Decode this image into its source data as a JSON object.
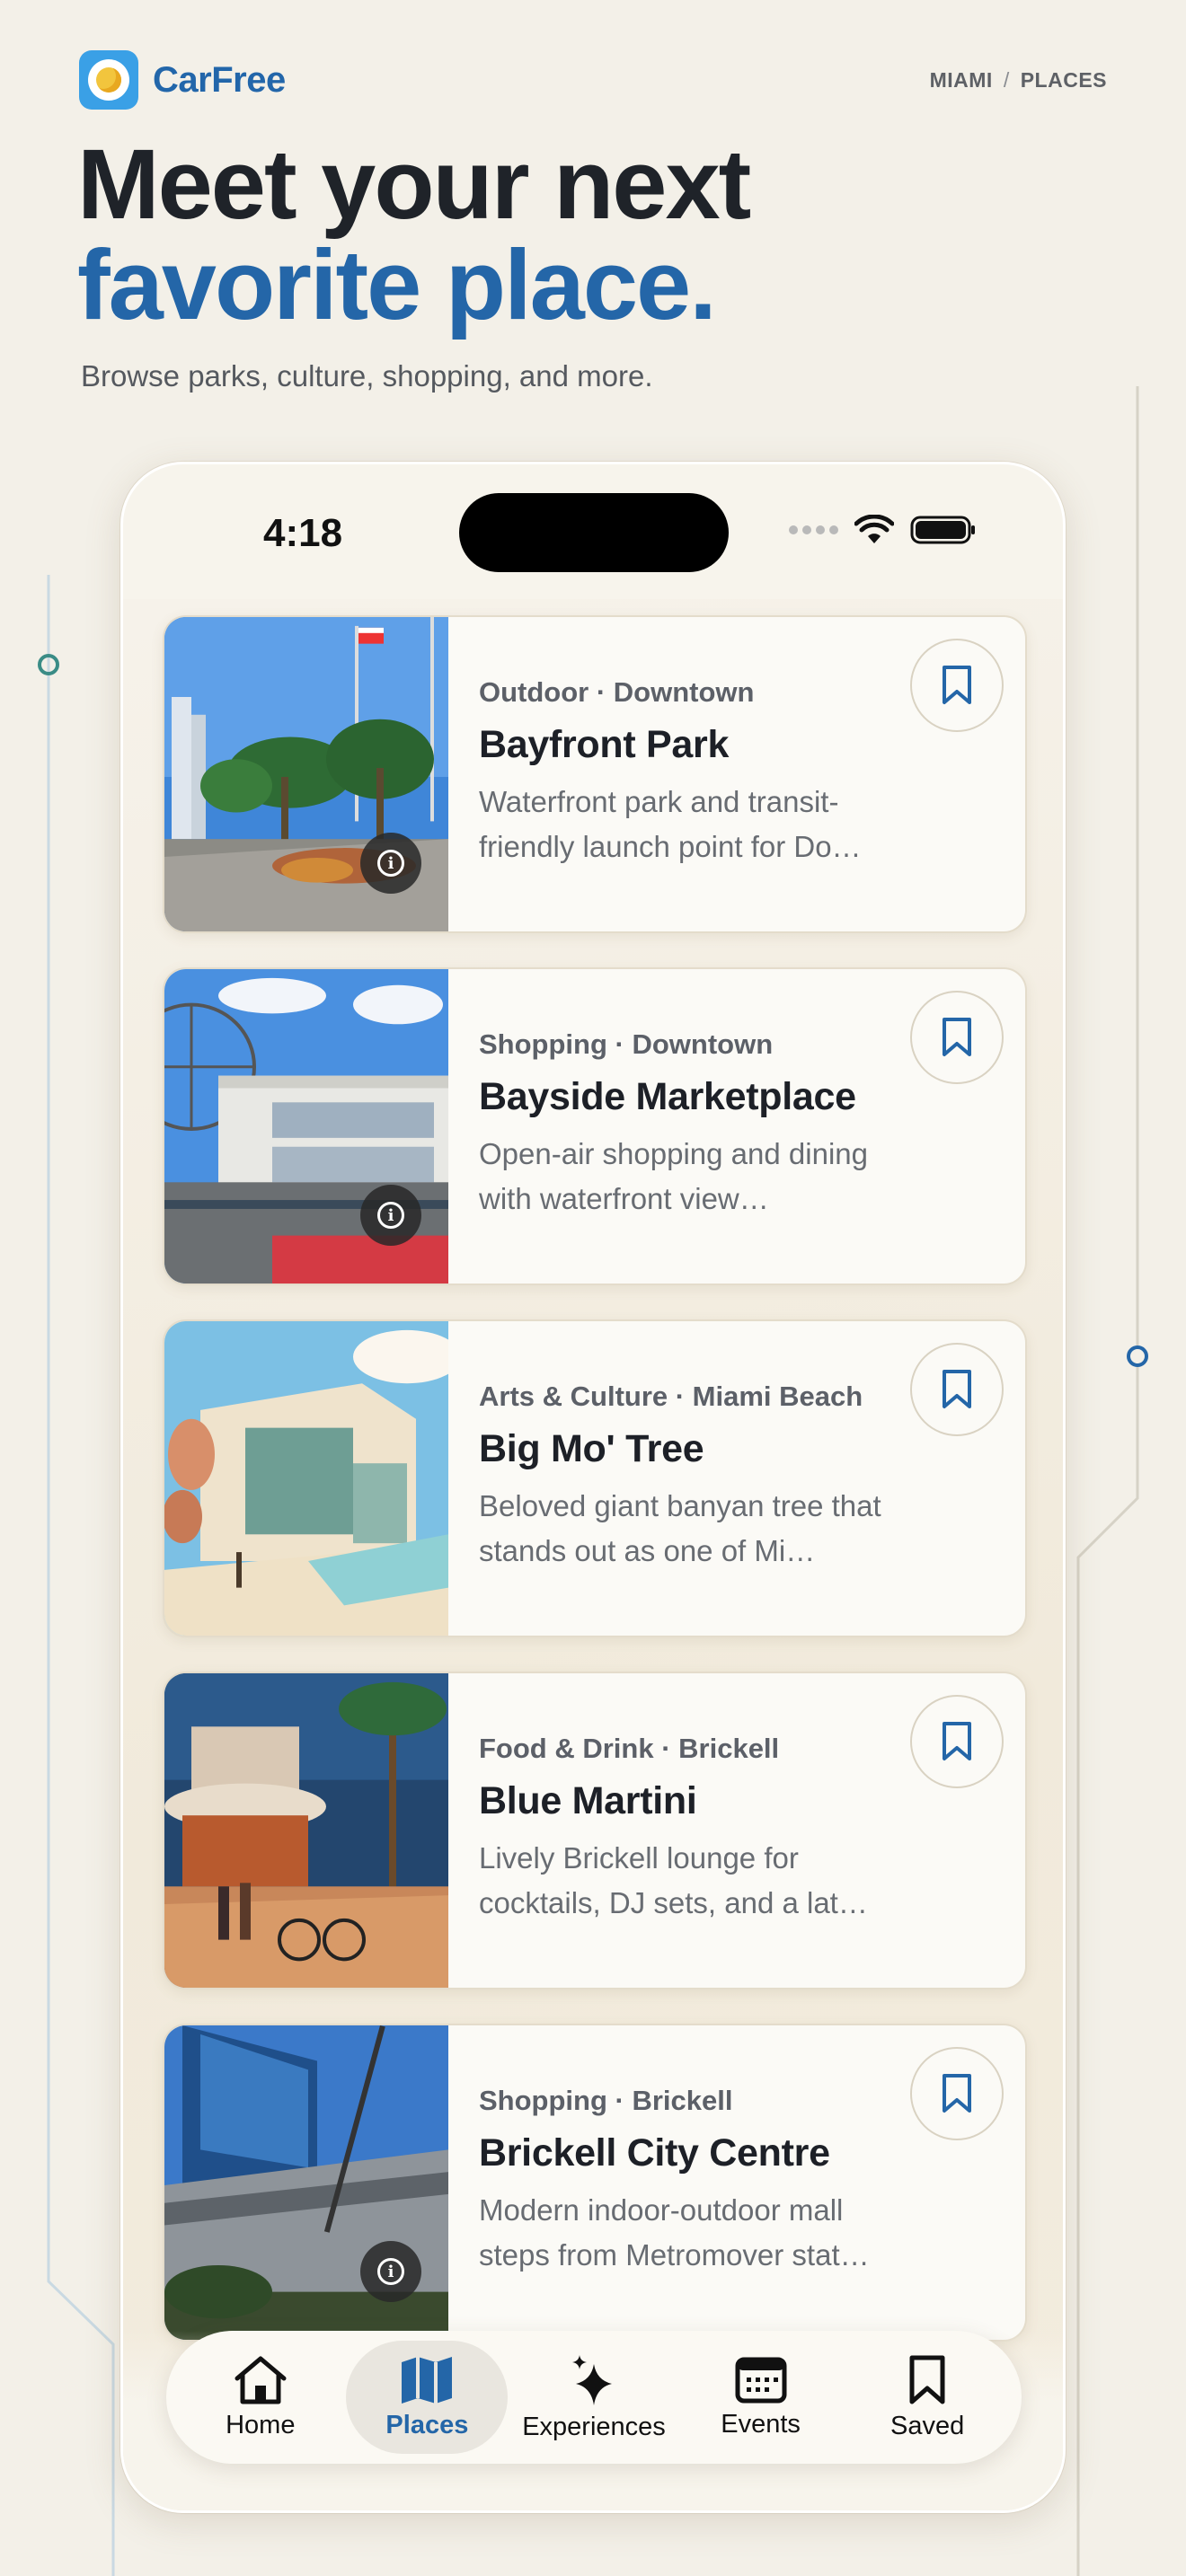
{
  "brand": {
    "name": "CarFree"
  },
  "breadcrumb": {
    "city": "MIAMI",
    "separator": "/",
    "section": "PLACES"
  },
  "hero": {
    "title_line1": "Meet your next",
    "title_line2": "favorite place.",
    "subtitle": "Browse parks, culture, shopping, and more."
  },
  "status_bar": {
    "time": "4:18"
  },
  "places": [
    {
      "category": "Outdoor · Downtown",
      "title": "Bayfront Park",
      "description": "Waterfront park and transit-friendly launch point for Do…",
      "has_info": true
    },
    {
      "category": "Shopping · Downtown",
      "title": "Bayside Marketplace",
      "description": "Open-air shopping and dining with waterfront view…",
      "has_info": true
    },
    {
      "category": "Arts & Culture · Miami Beach",
      "title": "Big Mo' Tree",
      "description": "Beloved giant banyan tree that stands out as one of Mi…",
      "has_info": false
    },
    {
      "category": "Food & Drink · Brickell",
      "title": "Blue Martini",
      "description": "Lively Brickell lounge for cocktails, DJ sets, and a lat…",
      "has_info": false
    },
    {
      "category": "Shopping · Brickell",
      "title": "Brickell City Centre",
      "description": "Modern indoor-outdoor mall steps from Metromover stat…",
      "has_info": true
    }
  ],
  "tabs": [
    {
      "label": "Home",
      "icon": "house-icon",
      "active": false
    },
    {
      "label": "Places",
      "icon": "map-icon",
      "active": true
    },
    {
      "label": "Experiences",
      "icon": "sparkle-icon",
      "active": false
    },
    {
      "label": "Events",
      "icon": "calendar-icon",
      "active": false
    },
    {
      "label": "Saved",
      "icon": "bookmark-icon",
      "active": false
    }
  ],
  "colors": {
    "accent": "#2466a8",
    "background": "#f3f0e8",
    "text": "#1f2329"
  }
}
